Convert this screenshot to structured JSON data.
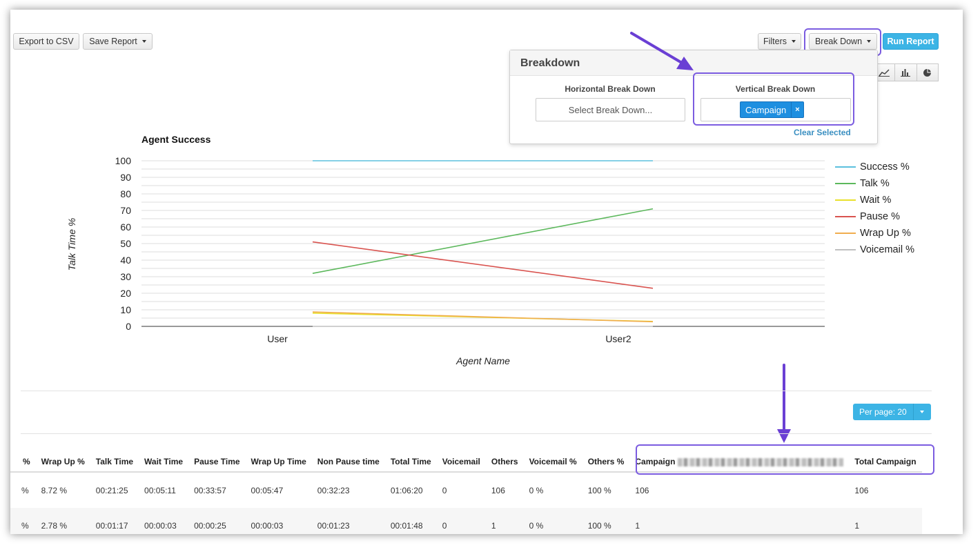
{
  "toolbar": {
    "export_label": "Export to CSV",
    "save_label": "Save Report",
    "filters_label": "Filters",
    "breakdown_label": "Break Down",
    "run_label": "Run Report"
  },
  "breakdown_panel": {
    "title": "Breakdown",
    "horizontal_label": "Horizontal Break Down",
    "horizontal_placeholder": "Select Break Down...",
    "vertical_label": "Vertical Break Down",
    "vertical_chip": "Campaign",
    "chip_remove": "×",
    "clear_label": "Clear Selected"
  },
  "chart_type_icons": [
    "line-chart-icon",
    "bar-chart-icon",
    "pie-chart-icon"
  ],
  "annotation_color": "#7b5ce0",
  "chart_data": {
    "type": "line",
    "title": "Agent Success",
    "xlabel": "Agent Name",
    "ylabel": "Talk Time %",
    "categories": [
      "User",
      "User2"
    ],
    "ylim": [
      0,
      100
    ],
    "yticks": [
      0,
      10,
      20,
      30,
      40,
      50,
      60,
      70,
      80,
      90,
      100
    ],
    "grid": true,
    "legend_position": "right",
    "series": [
      {
        "name": "Success %",
        "color": "#5bc0de",
        "values": [
          100,
          100
        ]
      },
      {
        "name": "Talk %",
        "color": "#5cb85c",
        "values": [
          32,
          71
        ]
      },
      {
        "name": "Wait %",
        "color": "#e8e02a",
        "values": [
          8,
          3
        ]
      },
      {
        "name": "Pause %",
        "color": "#d9534f",
        "values": [
          51,
          23
        ]
      },
      {
        "name": "Wrap Up %",
        "color": "#f0ad4e",
        "values": [
          8.72,
          2.78
        ]
      },
      {
        "name": "Voicemail %",
        "color": "#c0c0c0",
        "values": [
          0,
          0
        ]
      }
    ]
  },
  "pagination": {
    "per_page_label": "Per page: 20"
  },
  "table": {
    "headers": [
      "%",
      "Wrap Up %",
      "Talk Time",
      "Wait Time",
      "Pause Time",
      "Wrap Up Time",
      "Non Pause time",
      "Total Time",
      "Voicemail",
      "Others",
      "Voicemail %",
      "Others %",
      "Campaign",
      "Total Campaign"
    ],
    "rows": [
      [
        "%",
        "8.72 %",
        "00:21:25",
        "00:05:11",
        "00:33:57",
        "00:05:47",
        "00:32:23",
        "01:06:20",
        "0",
        "106",
        "0 %",
        "100 %",
        "106",
        "106"
      ],
      [
        "%",
        "2.78 %",
        "00:01:17",
        "00:00:03",
        "00:00:25",
        "00:00:03",
        "00:01:23",
        "00:01:48",
        "0",
        "1",
        "0 %",
        "100 %",
        "1",
        "1"
      ]
    ]
  }
}
